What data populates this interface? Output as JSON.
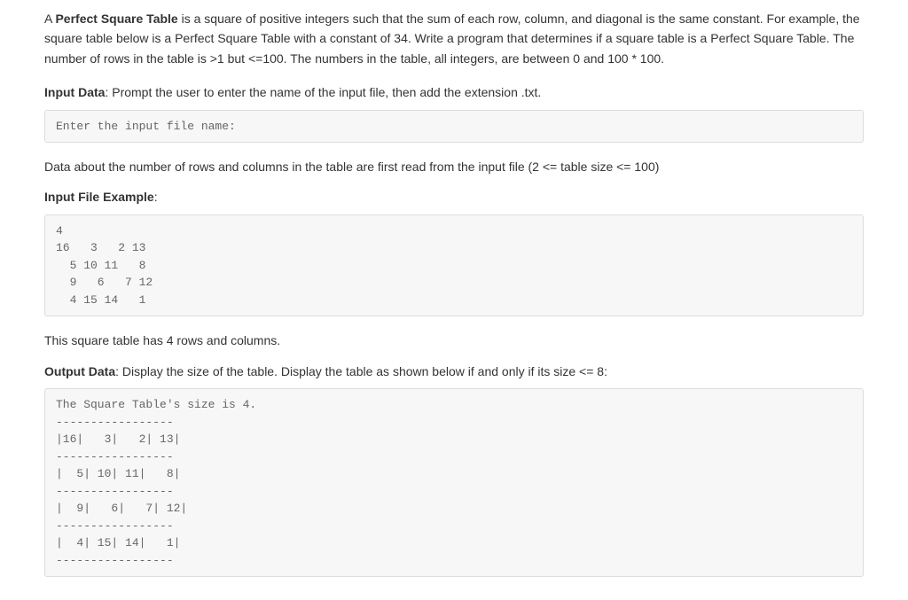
{
  "intro": {
    "prefix": "A ",
    "bold_term": "Perfect Square Table",
    "body": " is a square of positive integers such that the sum of each row, column, and diagonal is the same constant. For example, the square table below is a Perfect Square Table with a constant of 34. Write a program that determines if a square table is a Perfect Square Table. The number of rows in the table is >1 but <=100. The numbers in the table, all integers, are between 0 and 100 * 100."
  },
  "input_data": {
    "label": "Input Data",
    "text": ": Prompt the user to enter the name of the input file, then add the extension .txt."
  },
  "code_prompt": "Enter the input file name:",
  "input_file_desc": "Data about the number of rows and columns in the table are first read from the input file (2 <= table size <= 100)",
  "input_file_example_label": "Input File Example",
  "input_file_example_colon": ":",
  "code_input_example": "4\n16   3   2 13\n  5 10 11   8\n  9   6   7 12\n  4 15 14   1",
  "rows_desc": "This square table has 4 rows and columns.",
  "output_data": {
    "label": "Output Data",
    "text": ": Display the size of the table. Display the table as shown below if and only if its size <= 8:"
  },
  "code_output_example": "The Square Table's size is 4.\n-----------------\n|16|   3|   2| 13|\n-----------------\n|  5| 10| 11|   8|\n-----------------\n|  9|   6|   7| 12|\n-----------------\n|  4| 15| 14|   1|\n-----------------"
}
